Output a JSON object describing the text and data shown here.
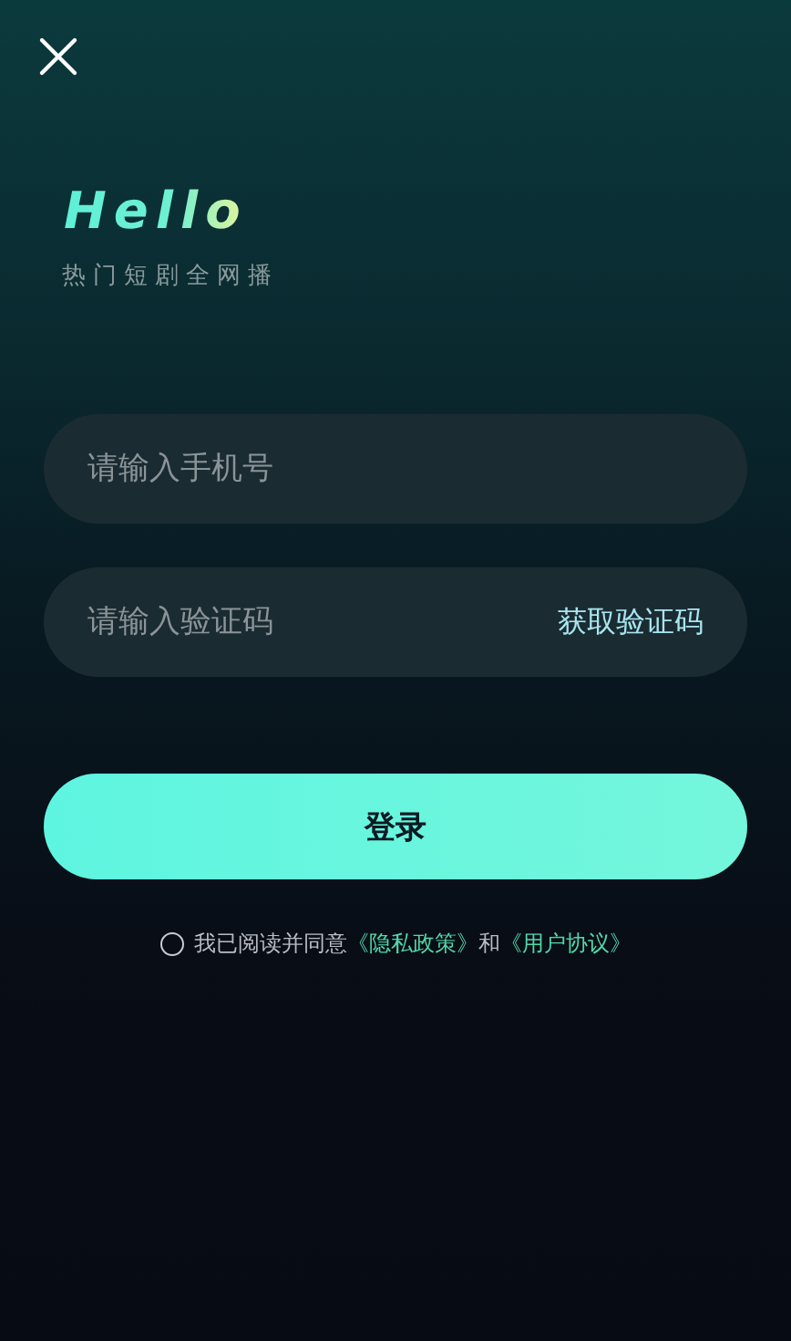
{
  "header": {
    "title": "Hello",
    "subtitle": "热门短剧全网播"
  },
  "phone_field": {
    "placeholder": "请输入手机号"
  },
  "code_field": {
    "placeholder": "请输入验证码",
    "action": "获取验证码"
  },
  "login_button": {
    "label": "登录"
  },
  "agreement": {
    "checked": false,
    "prefix": "我已阅读并同意",
    "privacy_link": "《隐私政策》",
    "joiner": "和",
    "terms_link": "《用户协议》"
  }
}
